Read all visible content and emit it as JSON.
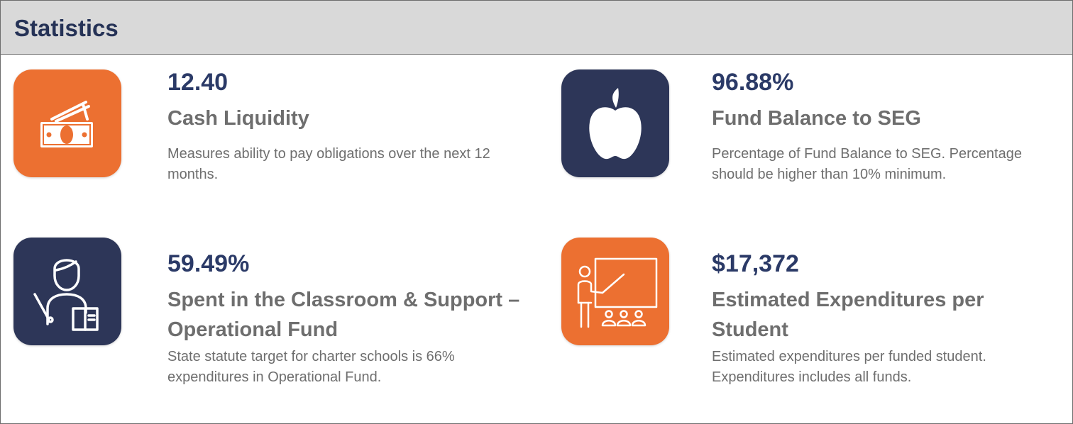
{
  "header": {
    "title": "Statistics",
    "background": "#d9d9d9",
    "title_color": "#253256"
  },
  "colors": {
    "orange": "#ec7031",
    "navy": "#2d3658",
    "value_text": "#2b3a67",
    "body_text": "#6e6e6e"
  },
  "stats": [
    {
      "icon": "money-bills-icon",
      "tile_color": "#ec7031",
      "value": "12.40",
      "title": "Cash Liquidity",
      "description": "Measures ability to pay obligations over the next 12 months."
    },
    {
      "icon": "apple-icon",
      "tile_color": "#2d3658",
      "value": "96.88%",
      "title": "Fund Balance to SEG",
      "description": "Percentage of Fund Balance to SEG. Percentage should be higher than 10% minimum."
    },
    {
      "icon": "teacher-with-book-icon",
      "tile_color": "#2d3658",
      "value": "59.49%",
      "title": "Spent in the Classroom & Support – Operational Fund",
      "description": "State statute target for charter schools is 66% expenditures in Operational Fund."
    },
    {
      "icon": "classroom-presentation-icon",
      "tile_color": "#ec7031",
      "value": "$17,372",
      "title": "Estimated Expenditures per Student",
      "description": "Estimated expenditures per funded student.  Expenditures includes all funds."
    }
  ]
}
